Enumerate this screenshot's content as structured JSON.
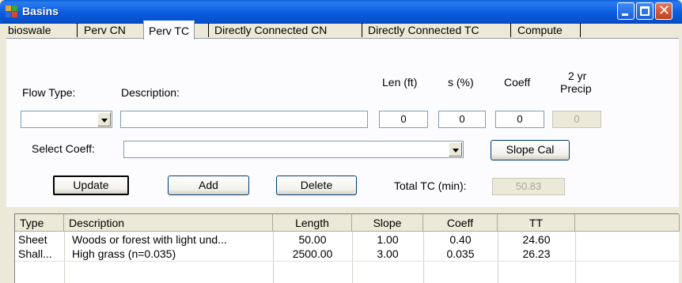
{
  "window": {
    "title": "Basins",
    "icon": "app-grid-icon",
    "controls": [
      "minimize-icon",
      "maximize-icon",
      "close-icon"
    ]
  },
  "tabs": [
    {
      "label": "bioswale"
    },
    {
      "label": "Perv CN"
    },
    {
      "label": "Perv TC",
      "selected": true
    },
    {
      "label": "Directly Connected CN"
    },
    {
      "label": "Directly Connected TC"
    },
    {
      "label": "Compute"
    }
  ],
  "form": {
    "flow_type_label": "Flow Type:",
    "flow_type_value": "",
    "description_label": "Description:",
    "description_value": "",
    "len_label": "Len (ft)",
    "len_value": "0",
    "s_label": "s (%)",
    "s_value": "0",
    "coeff_label": "Coeff",
    "coeff_value": "0",
    "precip_label_1": "2 yr",
    "precip_label_2": "Precip",
    "precip_value": "0",
    "select_coeff_label": "Select Coeff:",
    "select_coeff_value": "",
    "slope_cal_button": "Slope Cal",
    "update_button": "Update",
    "add_button": "Add",
    "delete_button": "Delete",
    "total_tc_label": "Total TC (min):",
    "total_tc_value": "50.83"
  },
  "grid": {
    "columns": [
      "Type",
      "Description",
      "Length",
      "Slope",
      "Coeff",
      "TT"
    ],
    "rows": [
      [
        "Sheet",
        "Woods or forest with light und...",
        "50.00",
        "1.00",
        "0.40",
        "24.60"
      ],
      [
        "Shall...",
        "High grass (n=0.035)",
        "2500.00",
        "3.00",
        "0.035",
        "26.23"
      ]
    ]
  },
  "colors": {
    "title_bar": "#0a5fd8",
    "window_face": "#ece9d8",
    "panel": "#fcfcfe",
    "close_button": "#c2401d"
  }
}
